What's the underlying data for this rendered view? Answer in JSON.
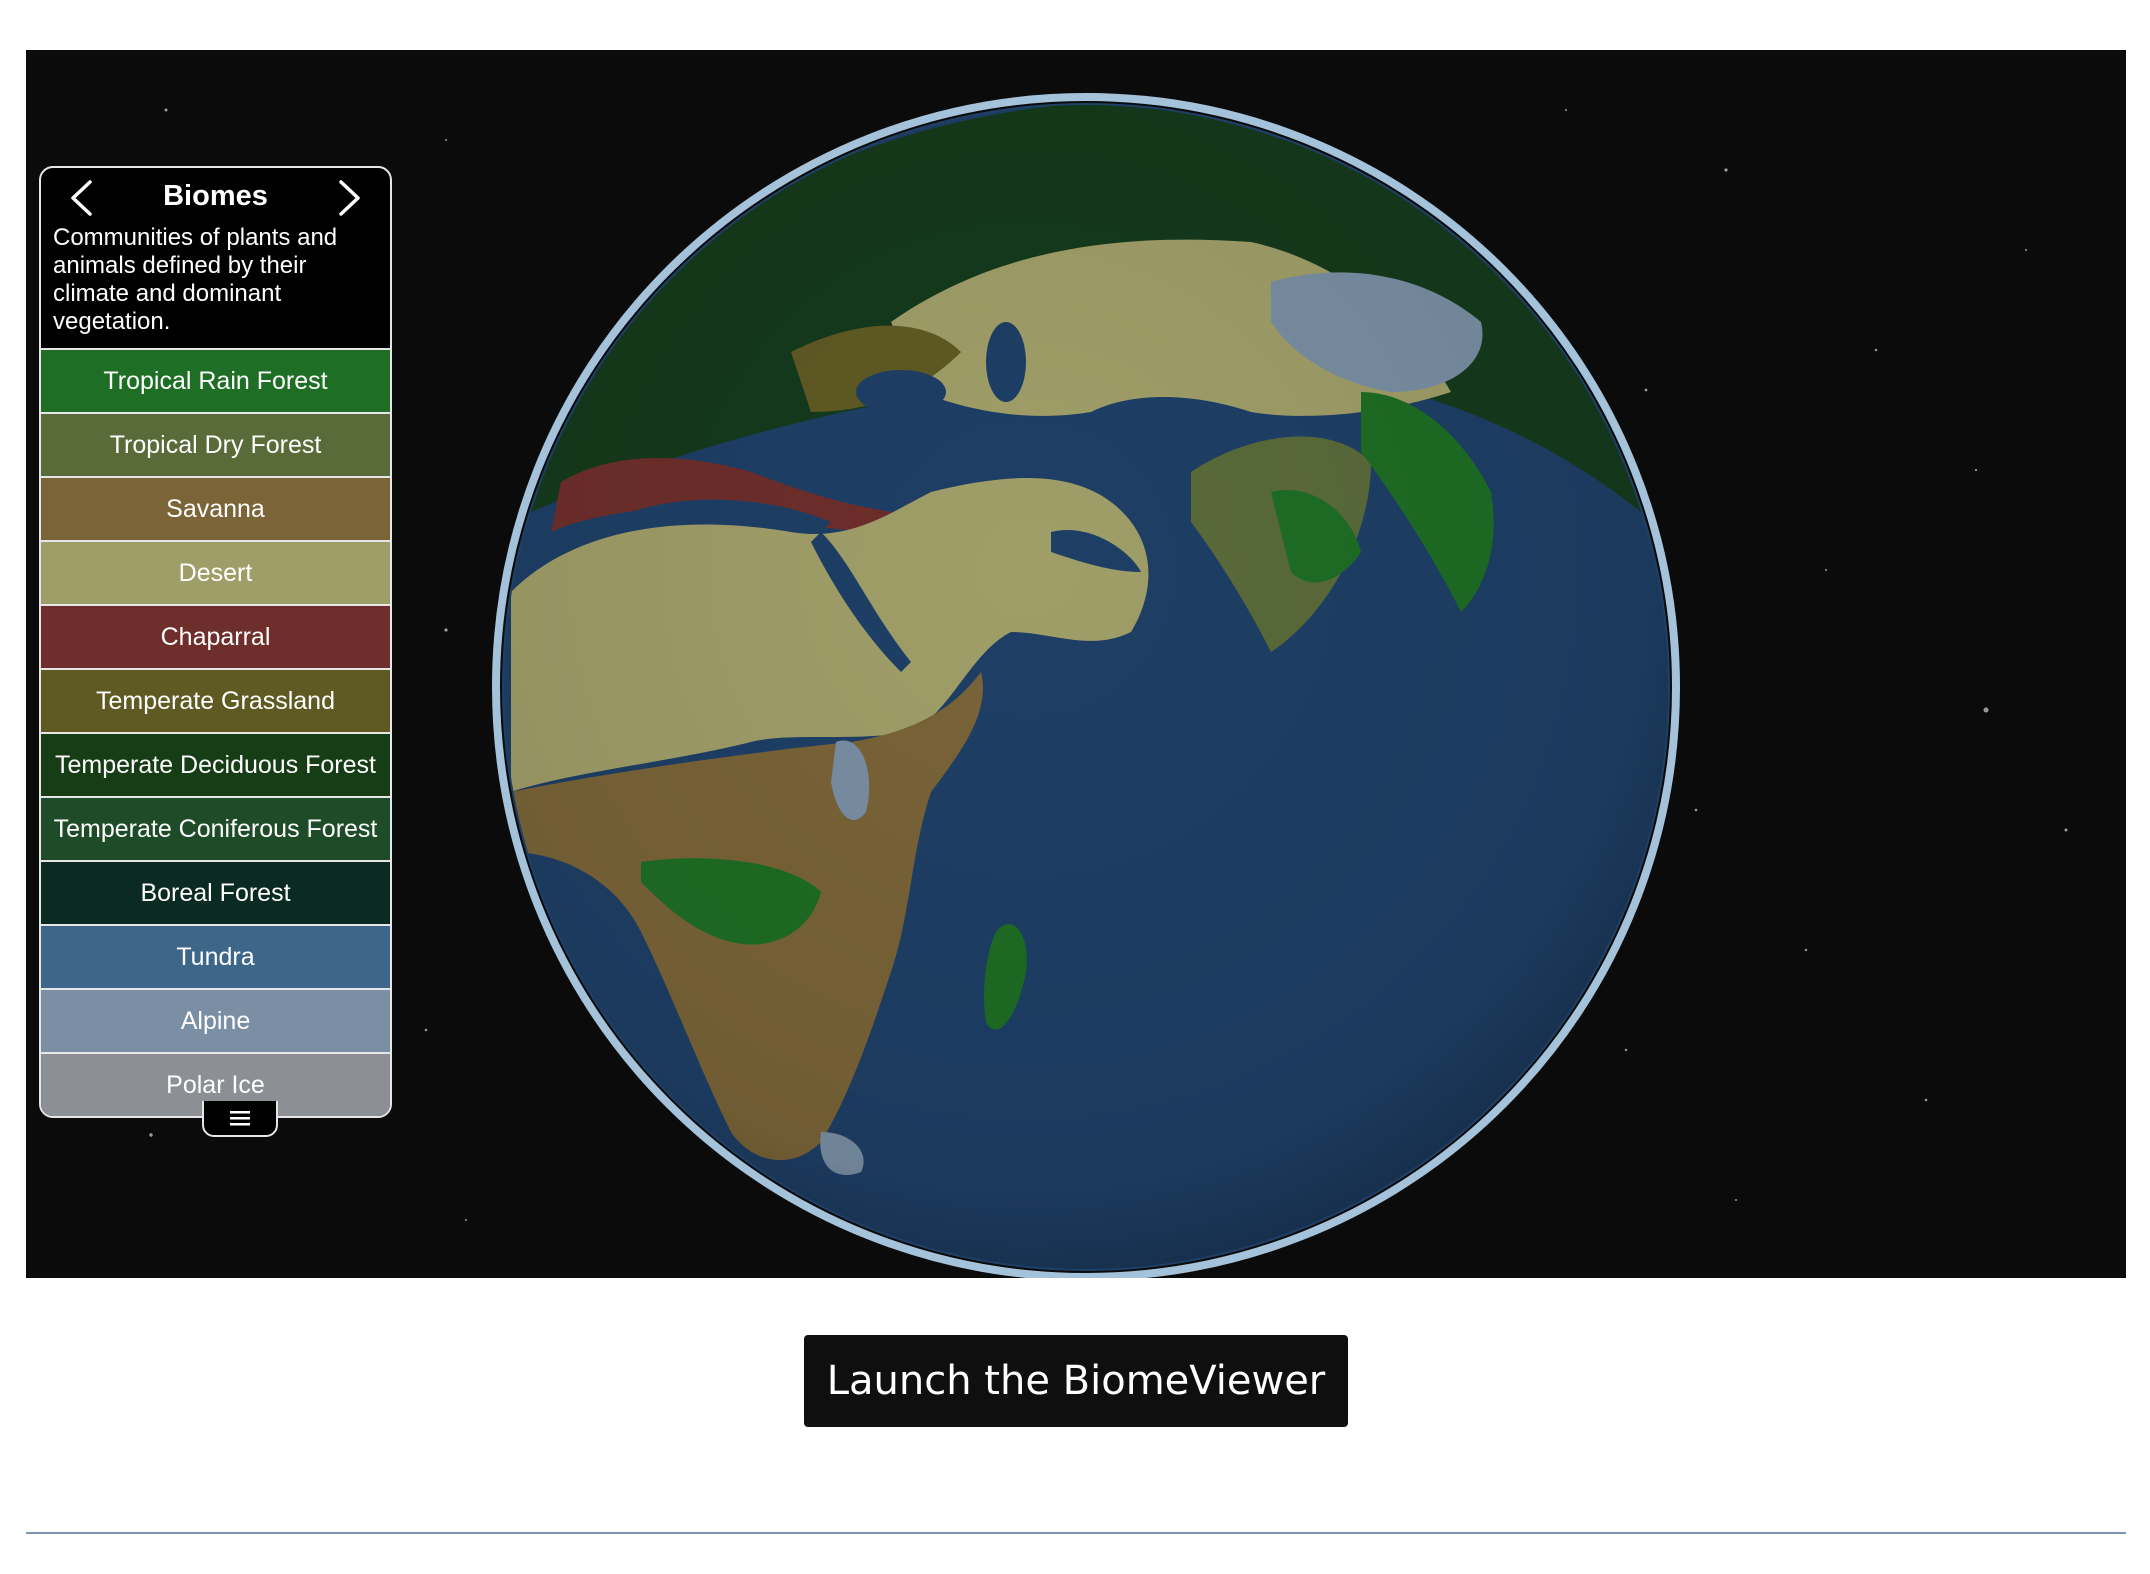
{
  "panel": {
    "title": "Biomes",
    "description": "Communities of plants and animals defined by their climate and dominant vegetation.",
    "prev_icon": "chevron-left-icon",
    "next_icon": "chevron-right-icon",
    "menu_icon": "hamburger-menu-icon",
    "items": [
      {
        "label": "Tropical Rain Forest",
        "color": "#1e6e25"
      },
      {
        "label": "Tropical Dry Forest",
        "color": "#5a6b3a"
      },
      {
        "label": "Savanna",
        "color": "#7a6438"
      },
      {
        "label": "Desert",
        "color": "#a09e68"
      },
      {
        "label": "Chaparral",
        "color": "#6e2e2b"
      },
      {
        "label": "Temperate Grassland",
        "color": "#5f5a24"
      },
      {
        "label": "Temperate Deciduous Forest",
        "color": "#163d16"
      },
      {
        "label": "Temperate Coniferous Forest",
        "color": "#1f4c28"
      },
      {
        "label": "Boreal Forest",
        "color": "#0b2a22"
      },
      {
        "label": "Tundra",
        "color": "#3e6689"
      },
      {
        "label": "Alpine",
        "color": "#7a8fa4"
      },
      {
        "label": "Polar Ice",
        "color": "#8c9095"
      }
    ]
  },
  "launch_button": {
    "label": "Launch the BiomeViewer"
  },
  "colors": {
    "ocean": "#1e3f66",
    "atmosphere": "#bfe3ff",
    "background": "#0b0b0b"
  }
}
